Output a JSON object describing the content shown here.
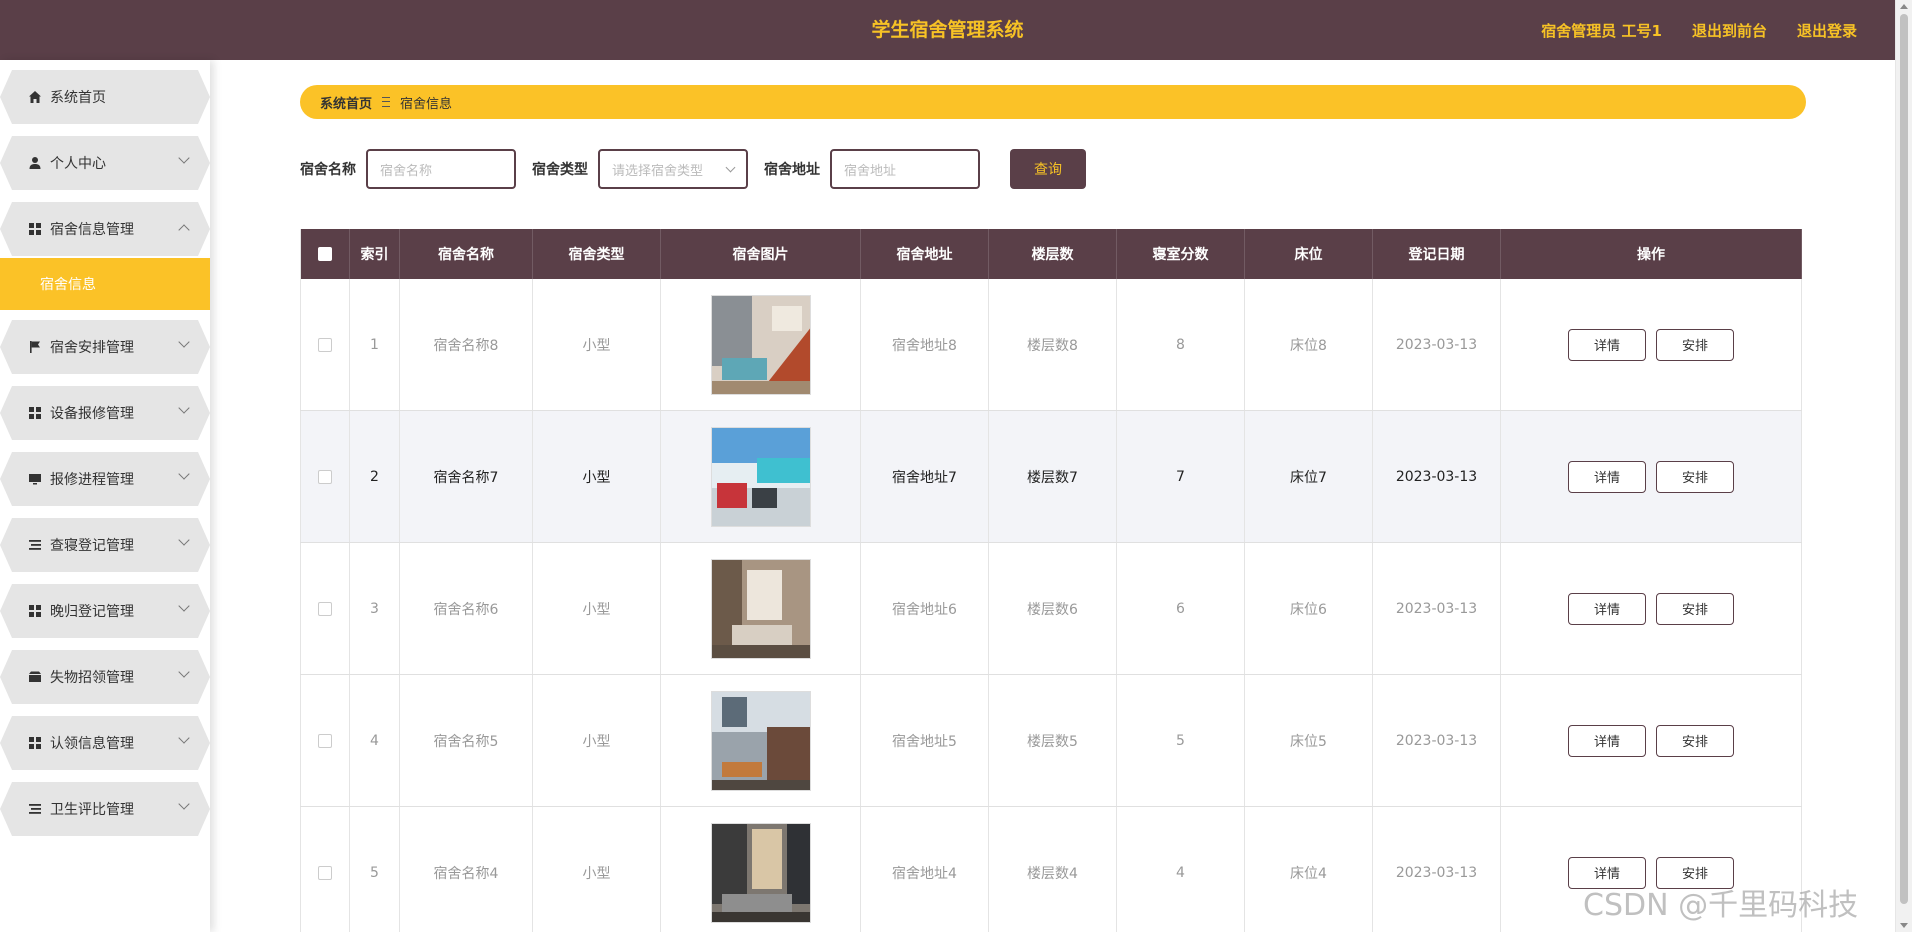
{
  "header": {
    "title": "学生宿舍管理系统",
    "user": "宿舍管理员 工号1",
    "front_link": "退出到前台",
    "logout_link": "退出登录"
  },
  "sidebar": {
    "items": [
      {
        "label": "系统首页",
        "icon": "home-icon"
      },
      {
        "label": "个人中心",
        "icon": "user-icon"
      },
      {
        "label": "宿舍信息管理",
        "icon": "grid-icon"
      },
      {
        "label": "宿舍安排管理",
        "icon": "flag-icon"
      },
      {
        "label": "设备报修管理",
        "icon": "grid-icon"
      },
      {
        "label": "报修进程管理",
        "icon": "monitor-icon"
      },
      {
        "label": "查寝登记管理",
        "icon": "list-icon"
      },
      {
        "label": "晚归登记管理",
        "icon": "grid-icon"
      },
      {
        "label": "失物招领管理",
        "icon": "box-icon"
      },
      {
        "label": "认领信息管理",
        "icon": "grid-icon"
      },
      {
        "label": "卫生评比管理",
        "icon": "list-icon"
      }
    ],
    "active_sub": "宿舍信息"
  },
  "breadcrumb": {
    "home": "系统首页",
    "current": "宿舍信息"
  },
  "search": {
    "name_label": "宿舍名称",
    "name_placeholder": "宿舍名称",
    "type_label": "宿舍类型",
    "type_placeholder": "请选择宿舍类型",
    "addr_label": "宿舍地址",
    "addr_placeholder": "宿舍地址",
    "query_button": "查询"
  },
  "table": {
    "headers": [
      "索引",
      "宿舍名称",
      "宿舍类型",
      "宿舍图片",
      "宿舍地址",
      "楼层数",
      "寝室分数",
      "床位",
      "登记日期",
      "操作"
    ],
    "rows": [
      {
        "index": "1",
        "name": "宿舍名称8",
        "type": "小型",
        "address": "宿舍地址8",
        "floors": "楼层数8",
        "score": "8",
        "bed": "床位8",
        "date": "2023-03-13"
      },
      {
        "index": "2",
        "name": "宿舍名称7",
        "type": "小型",
        "address": "宿舍地址7",
        "floors": "楼层数7",
        "score": "7",
        "bed": "床位7",
        "date": "2023-03-13"
      },
      {
        "index": "3",
        "name": "宿舍名称6",
        "type": "小型",
        "address": "宿舍地址6",
        "floors": "楼层数6",
        "score": "6",
        "bed": "床位6",
        "date": "2023-03-13"
      },
      {
        "index": "4",
        "name": "宿舍名称5",
        "type": "小型",
        "address": "宿舍地址5",
        "floors": "楼层数5",
        "score": "5",
        "bed": "床位5",
        "date": "2023-03-13"
      },
      {
        "index": "5",
        "name": "宿舍名称4",
        "type": "小型",
        "address": "宿舍地址4",
        "floors": "楼层数4",
        "score": "4",
        "bed": "床位4",
        "date": "2023-03-13"
      }
    ],
    "detail_button": "详情",
    "arrange_button": "安排"
  },
  "watermark": "CSDN @千里码科技",
  "colors": {
    "primary": "#5a3f48",
    "accent": "#fbc227"
  }
}
